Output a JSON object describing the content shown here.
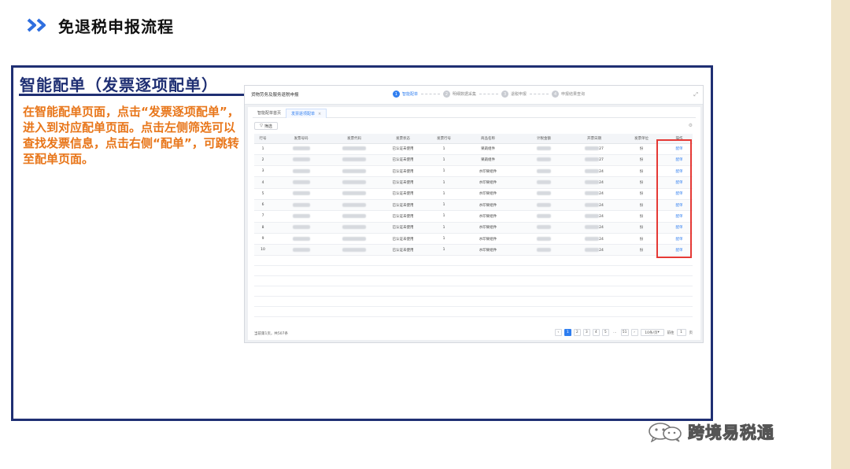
{
  "slide": {
    "title": "免退税申报流程",
    "section_title": "智能配单（发票逐项配单）",
    "description": "在智能配单页面，点击“发票逐项配单”，进入到对应配单页面。点击左侧筛选可以查找发票信息，点击右侧“配单”，可跳转至配单页面。"
  },
  "app": {
    "title": "货物劳务及服务退税申报",
    "steps": [
      {
        "num": "1",
        "label": "智能配单"
      },
      {
        "num": "2",
        "label": "明细数据采集"
      },
      {
        "num": "3",
        "label": "退税申报"
      },
      {
        "num": "4",
        "label": "申报结果查询"
      }
    ],
    "tabs": [
      "智能配单首页",
      "发票逐项配单"
    ],
    "filter_label": "筛选",
    "columns": [
      "行号",
      "发票号码",
      "发票代码",
      "发票状态",
      "发票行号",
      "商品名称",
      "计税金额",
      "开票日期",
      "发票单位",
      "操作"
    ],
    "rows": [
      {
        "no": "1",
        "status": "已认证未使用",
        "line": "1",
        "product": "果蔬组件",
        "date_suffix": "27",
        "unit": "份",
        "op": "配单"
      },
      {
        "no": "2",
        "status": "已认证未使用",
        "line": "1",
        "product": "果蔬组件",
        "date_suffix": "27",
        "unit": "份",
        "op": "配单"
      },
      {
        "no": "3",
        "status": "已认证未使用",
        "line": "1",
        "product": "水印果组件",
        "date_suffix": "24",
        "unit": "份",
        "op": "配单"
      },
      {
        "no": "4",
        "status": "已认证未使用",
        "line": "1",
        "product": "水印果组件",
        "date_suffix": "24",
        "unit": "份",
        "op": "配单"
      },
      {
        "no": "5",
        "status": "已认证未使用",
        "line": "1",
        "product": "水印果组件",
        "date_suffix": "24",
        "unit": "份",
        "op": "配单"
      },
      {
        "no": "6",
        "status": "已认证未使用",
        "line": "1",
        "product": "水印果组件",
        "date_suffix": "24",
        "unit": "份",
        "op": "配单"
      },
      {
        "no": "7",
        "status": "已认证未使用",
        "line": "1",
        "product": "水印果组件",
        "date_suffix": "24",
        "unit": "份",
        "op": "配单"
      },
      {
        "no": "8",
        "status": "已认证未使用",
        "line": "1",
        "product": "水印果组件",
        "date_suffix": "24",
        "unit": "份",
        "op": "配单"
      },
      {
        "no": "9",
        "status": "已认证未使用",
        "line": "1",
        "product": "水印果组件",
        "date_suffix": "24",
        "unit": "份",
        "op": "配单"
      },
      {
        "no": "10",
        "status": "已认证未使用",
        "line": "1",
        "product": "水印果组件",
        "date_suffix": "24",
        "unit": "份",
        "op": "配单"
      }
    ],
    "total_text": "当前第1页，共507条",
    "pages": [
      "1",
      "2",
      "3",
      "4",
      "5",
      "…",
      "51"
    ],
    "page_size": "10条/页",
    "goto_label": "前往",
    "goto_value": "1",
    "page_unit": "页"
  },
  "watermark": "跨境易税通"
}
